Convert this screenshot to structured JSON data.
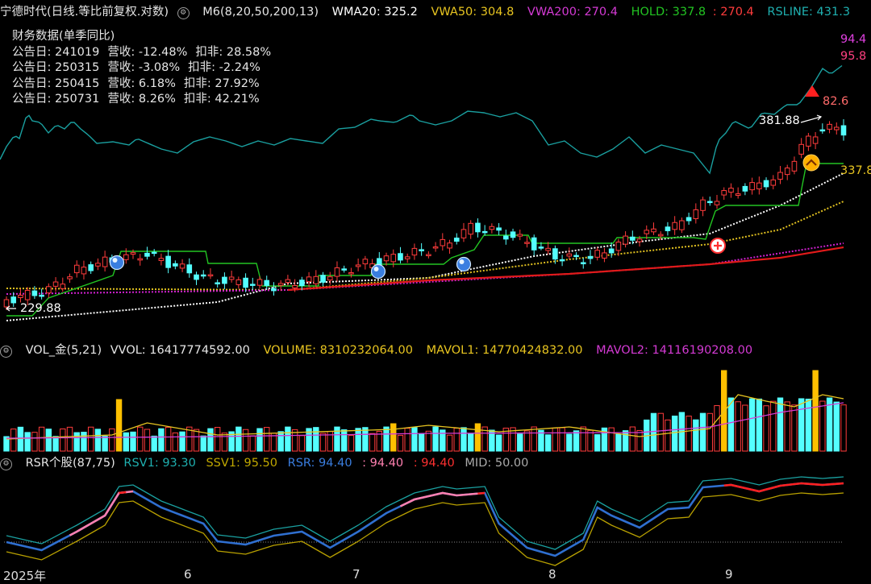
{
  "main_legend": {
    "stock_name": "宁德时代(日线.等比前复权.对数)",
    "m6": "M6(8,20,50,200,13)",
    "wma20": "WMA20: 325.2",
    "vwa50": "VWA50: 304.8",
    "vwa200": "VWA200: 270.4",
    "hold": "HOLD: 337.8",
    "hold2": ": 270.4",
    "rsline": "RSLINE: 431.3"
  },
  "financial": {
    "title": "财务数据(单季同比)",
    "rows": [
      {
        "date": "公告日: 241019",
        "rev": "营收:  -12.48%",
        "np": "扣非:  28.58%"
      },
      {
        "date": "公告日: 250315",
        "rev": "营收:  -3.08%",
        "np": "扣非:  -2.24%"
      },
      {
        "date": "公告日: 250415",
        "rev": "营收:  6.18%",
        "np": "扣非:  27.92%"
      },
      {
        "date": "公告日: 250731",
        "rev": "营收:  8.26%",
        "np": "扣非:  42.21%"
      }
    ]
  },
  "price_labels": {
    "right_top1": "94.4",
    "right_top2": "95.8",
    "high_value": "82.6",
    "high_price": "381.88",
    "hold_value": "337.8",
    "low_price": "229.88"
  },
  "volume_legend": {
    "name": "VOL_金(5,21)",
    "vvol": "VVOL: 16417774592.00",
    "volume": "VOLUME: 8310232064.00",
    "mavol1": "MAVOL1: 14770424832.00",
    "mavol2": "MAVOL2: 14116190208.00"
  },
  "rsr_legend": {
    "name": "RSR个股(87,75)",
    "rsv1": "RSV1: 93.30",
    "ssv1": "SSV1: 95.50",
    "rsr": "RSR: 94.40",
    "v1": ": 94.40",
    "v2": ": 94.40",
    "mid": "MID: 50.00"
  },
  "x_axis": {
    "start": "2025年",
    "m6": "6",
    "m7": "7",
    "m8": "8",
    "m9": "9"
  },
  "colors": {
    "up": "#ff3c3c",
    "down": "#54ffff",
    "hold": "#22c422",
    "rsline": "#1aa0a0",
    "wma20": "#ffffff",
    "vwa50": "#e0c020",
    "vwa200": "#d020d0",
    "ma200": "#e01a1a",
    "gold_bar": "#ffc000",
    "rsv1": "#1aa0a0",
    "ssv1": "#b8a000",
    "rsr": "#2f6fd0"
  }
}
